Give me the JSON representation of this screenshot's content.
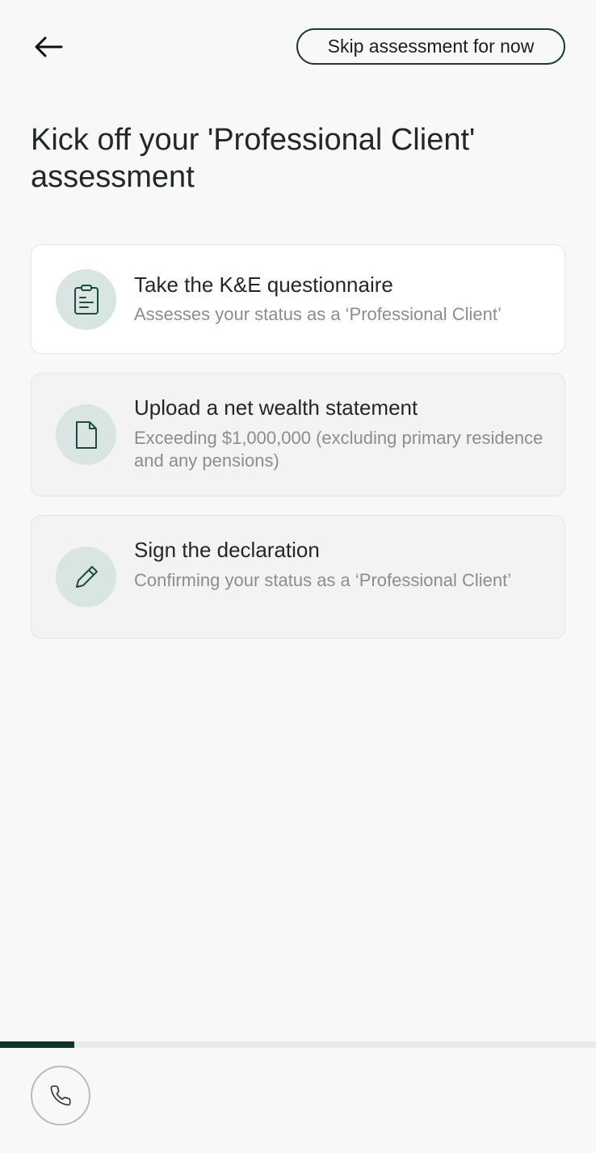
{
  "header": {
    "back_icon": "arrow-left-icon",
    "skip_label": "Skip assessment for now"
  },
  "page": {
    "title": "Kick off your 'Professional Client' assessment"
  },
  "steps": [
    {
      "title": "Take the K&E questionnaire",
      "description": "Assesses your status as a ‘Professional Client’",
      "icon": "clipboard-icon",
      "state": "active"
    },
    {
      "title": "Upload a net wealth statement",
      "description": "Exceeding $1,000,000 (excluding primary residence and any pensions)",
      "icon": "document-icon",
      "state": "inactive"
    },
    {
      "title": "Sign the declaration",
      "description": "Confirming your status as a ‘Professional Client’",
      "icon": "pencil-icon",
      "state": "inactive"
    }
  ],
  "progress": {
    "fraction": 0.125
  },
  "footer": {
    "call_icon": "phone-icon"
  },
  "colors": {
    "accent": "#14302a",
    "icon_bg": "#d9e5e3",
    "icon_stroke": "#1e4a3f",
    "background": "#f7f8f7"
  }
}
